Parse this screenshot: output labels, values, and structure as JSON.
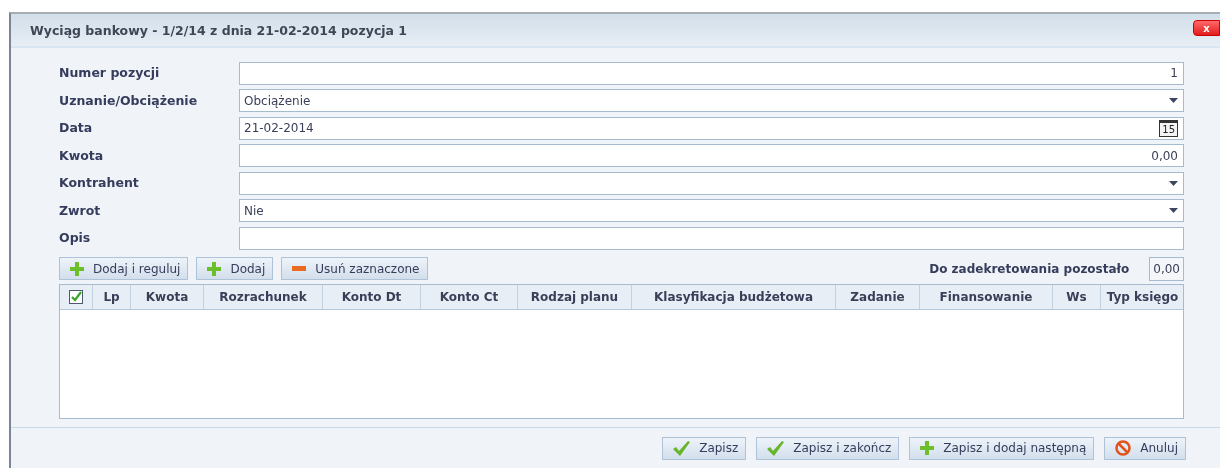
{
  "window": {
    "title": "Wyciąg bankowy - 1/2/14 z dnia 21-02-2014 pozycja 1",
    "close_label": "x"
  },
  "fields": [
    {
      "label": "Numer pozycji",
      "kind": "number",
      "value": "1"
    },
    {
      "label": "Uznanie/Obciążenie",
      "kind": "select",
      "value": "Obciążenie"
    },
    {
      "label": "Data",
      "kind": "date",
      "value": "21-02-2014",
      "calendar_day": "15"
    },
    {
      "label": "Kwota",
      "kind": "number",
      "value": "0,00"
    },
    {
      "label": "Kontrahent",
      "kind": "select"
    },
    {
      "label": "Zwrot",
      "kind": "select",
      "value": "Nie"
    },
    {
      "label": "Opis",
      "kind": "text"
    }
  ],
  "toolbar": {
    "buttons": [
      {
        "label": "Dodaj i reguluj",
        "kind": "add"
      },
      {
        "label": "Dodaj",
        "kind": "add"
      },
      {
        "label": "Usuń zaznaczone",
        "kind": "remove"
      }
    ],
    "remaining_label": "Do zadekretowania pozostało",
    "remaining_value": "0,00"
  },
  "table": {
    "select_all_checked": true,
    "columns": [
      "Lp",
      "Kwota",
      "Rozrachunek",
      "Konto Dt",
      "Konto Ct",
      "Rodzaj planu",
      "Klasyfikacja budżetowa",
      "Zadanie",
      "Finansowanie",
      "Ws",
      "Typ księgo"
    ]
  },
  "footer_buttons": [
    {
      "label": "Zapisz",
      "kind": "save"
    },
    {
      "label": "Zapisz i zakończ",
      "kind": "save"
    },
    {
      "label": "Zapisz i dodaj następną",
      "kind": "add"
    },
    {
      "label": "Anuluj",
      "kind": "cancel"
    }
  ]
}
